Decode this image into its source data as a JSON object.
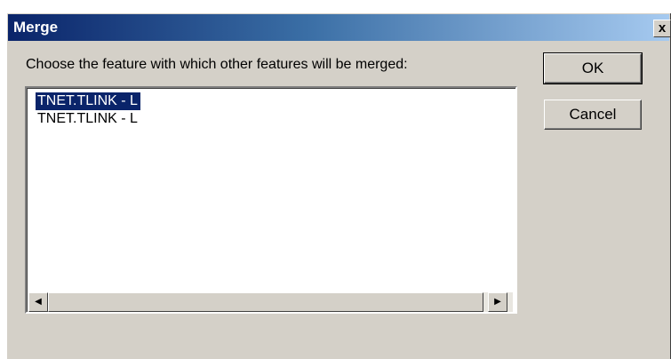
{
  "window": {
    "title": "Merge",
    "close_label": "x"
  },
  "prompt": "Choose the feature with which other features will be merged:",
  "list": {
    "items": [
      {
        "label": "TNET.TLINK - L",
        "selected": true
      },
      {
        "label": "TNET.TLINK - L",
        "selected": false
      }
    ]
  },
  "scrollbar": {
    "left_arrow": "◀",
    "right_arrow": "▶"
  },
  "buttons": {
    "ok": "OK",
    "cancel": "Cancel"
  },
  "colors": {
    "selection": "#0a246a",
    "face": "#d4d0c8"
  }
}
